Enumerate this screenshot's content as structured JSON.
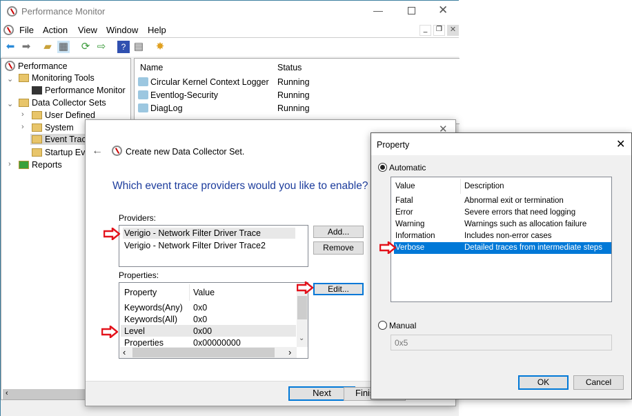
{
  "window": {
    "title": "Performance Monitor"
  },
  "menu": [
    "File",
    "Action",
    "View",
    "Window",
    "Help"
  ],
  "tree": [
    {
      "label": "Performance",
      "level": 0
    },
    {
      "label": "Monitoring Tools",
      "level": 1,
      "expanded": true
    },
    {
      "label": "Performance Monitor",
      "level": 2
    },
    {
      "label": "Data Collector Sets",
      "level": 1,
      "expanded": true
    },
    {
      "label": "User Defined",
      "level": 2,
      "expandable": true
    },
    {
      "label": "System",
      "level": 2,
      "expandable": true
    },
    {
      "label": "Event Trace",
      "level": 2,
      "selected": true
    },
    {
      "label": "Startup Eve",
      "level": 2
    },
    {
      "label": "Reports",
      "level": 1,
      "expandable": true
    }
  ],
  "list": {
    "columns": [
      "Name",
      "Status"
    ],
    "rows": [
      {
        "name": "Circular Kernel Context Logger",
        "status": "Running"
      },
      {
        "name": "Eventlog-Security",
        "status": "Running"
      },
      {
        "name": "DiagLog",
        "status": "Running"
      }
    ]
  },
  "wizard": {
    "title": "Create new Data Collector Set.",
    "heading": "Which event trace providers would you like to enable?",
    "providers_label": "Providers:",
    "providers": [
      "Verigio - Network Filter Driver Trace",
      "Verigio - Network Filter Driver Trace2"
    ],
    "add": "Add...",
    "remove": "Remove",
    "properties_label": "Properties:",
    "edit": "Edit...",
    "prop_columns": [
      "Property",
      "Value"
    ],
    "props": [
      {
        "p": "Keywords(Any)",
        "v": "0x0"
      },
      {
        "p": "Keywords(All)",
        "v": "0x0"
      },
      {
        "p": "Level",
        "v": "0x00"
      },
      {
        "p": "Properties",
        "v": "0x00000000"
      }
    ],
    "next": "Next",
    "finish": "Finish"
  },
  "property": {
    "title": "Property",
    "automatic": "Automatic",
    "columns": [
      "Value",
      "Description"
    ],
    "levels": [
      {
        "v": "Fatal",
        "d": "Abnormal exit or termination"
      },
      {
        "v": "Error",
        "d": "Severe errors that need logging"
      },
      {
        "v": "Warning",
        "d": "Warnings such as allocation failure"
      },
      {
        "v": "Information",
        "d": "Includes non-error cases"
      },
      {
        "v": "Verbose",
        "d": "Detailed traces from intermediate steps"
      }
    ],
    "selected": "Verbose",
    "manual": "Manual",
    "manual_value": "0x5",
    "ok": "OK",
    "cancel": "Cancel"
  },
  "colors": {
    "accent": "#0078d7",
    "heading": "#1c3c9c",
    "arrow": "#e3121b"
  }
}
